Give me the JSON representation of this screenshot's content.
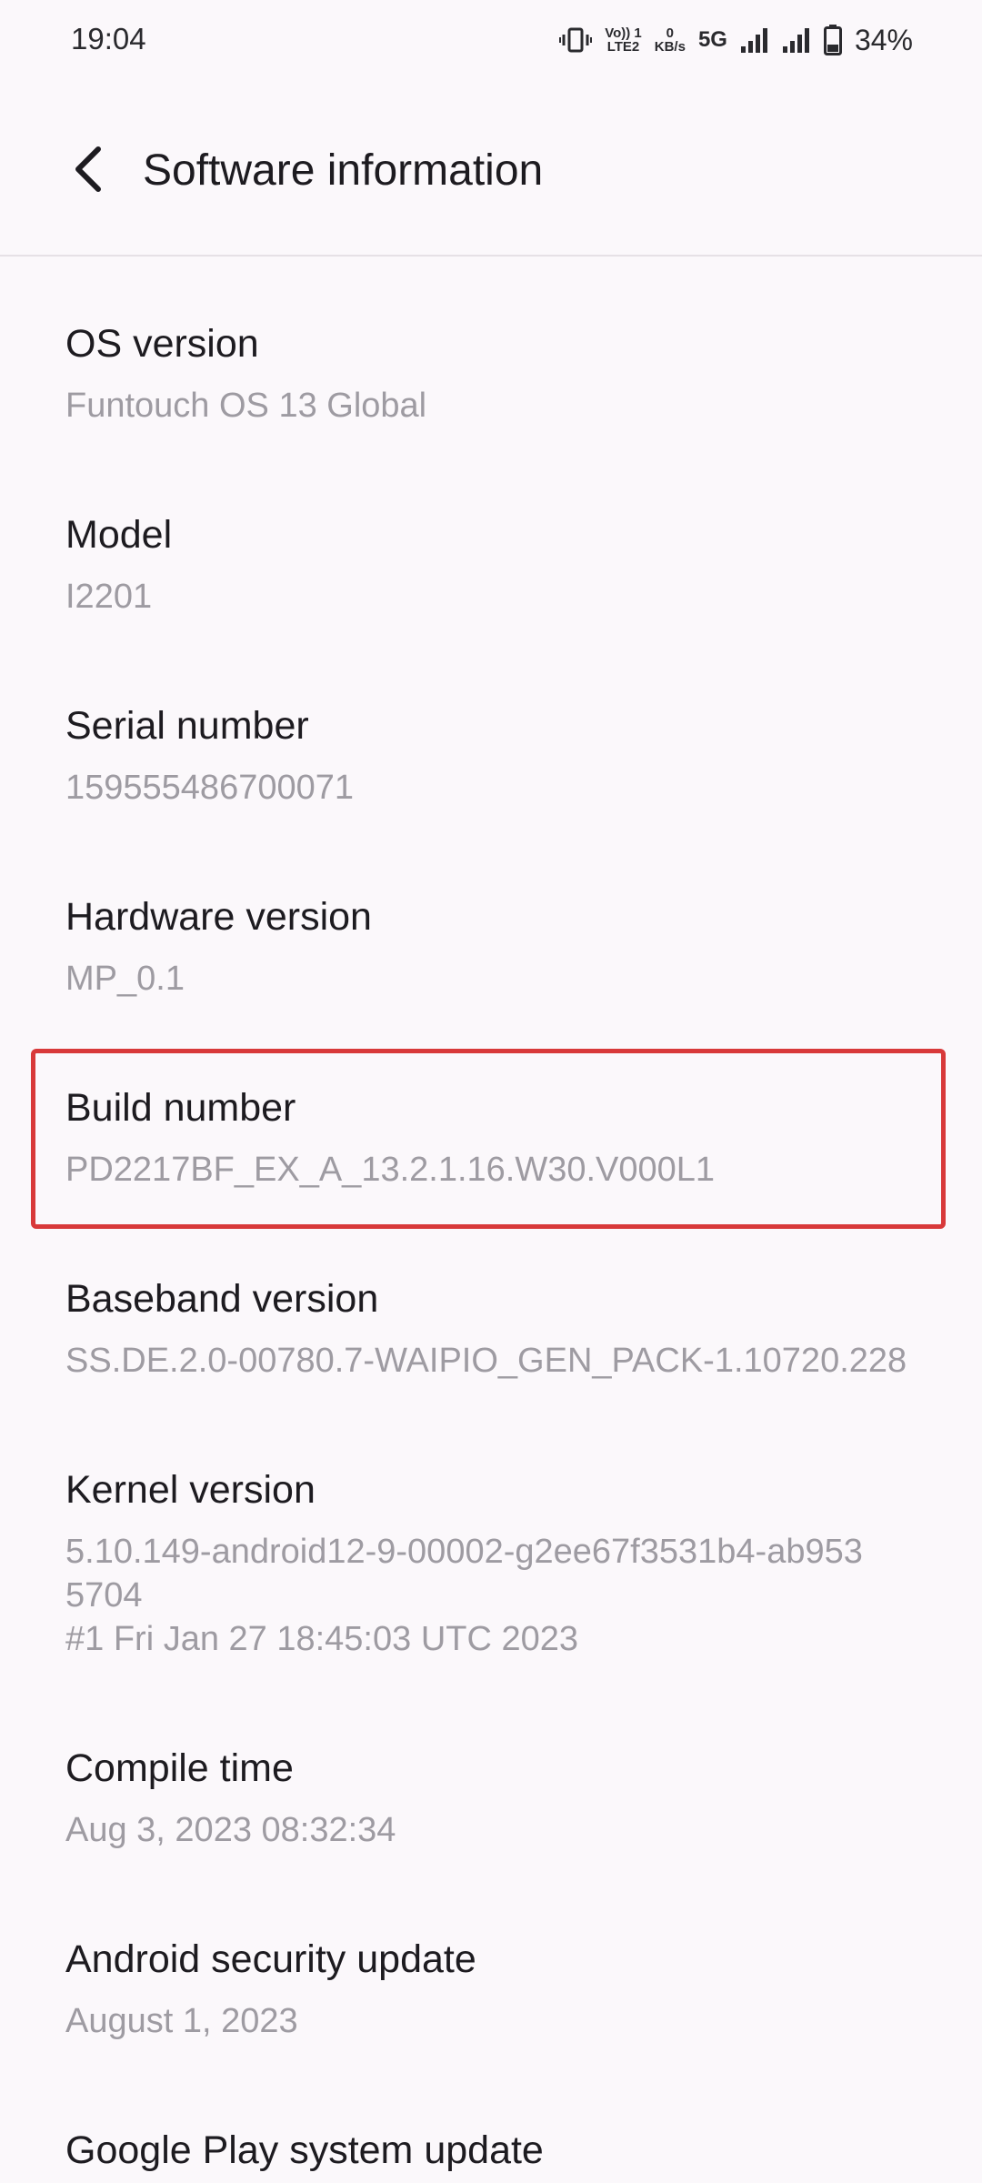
{
  "status_bar": {
    "time": "19:04",
    "volte_top": "Vo)) 1",
    "volte_bottom": "LTE2",
    "speed_top": "0",
    "speed_bottom": "KB/s",
    "network_type": "5G",
    "battery_percent": "34%",
    "icons": [
      "vibrate-icon",
      "volte-icon",
      "network-speed-icon",
      "signal-icon",
      "signal-icon",
      "battery-icon"
    ]
  },
  "header": {
    "title": "Software information",
    "back_icon": "chevron-left-icon"
  },
  "items": [
    {
      "title": "OS version",
      "value": "Funtouch OS 13 Global"
    },
    {
      "title": "Model",
      "value": "I2201"
    },
    {
      "title": "Serial number",
      "value": "159555486700071"
    },
    {
      "title": "Hardware version",
      "value": "MP_0.1"
    },
    {
      "title": "Build number",
      "value": "PD2217BF_EX_A_13.2.1.16.W30.V000L1"
    },
    {
      "title": "Baseband version",
      "value": "SS.DE.2.0-00780.7-WAIPIO_GEN_PACK-1.10720.228"
    },
    {
      "title": "Kernel version",
      "value_line1": "5.10.149-android12-9-00002-g2ee67f3531b4-ab953",
      "value_line2": "5704",
      "value_line3": "#1 Fri Jan 27 18:45:03 UTC 2023"
    },
    {
      "title": "Compile time",
      "value": "Aug 3, 2023 08:32:34"
    },
    {
      "title": "Android security update",
      "value": "August 1, 2023"
    },
    {
      "title": "Google Play system update"
    }
  ],
  "highlight": {
    "color": "#d8393a",
    "target": "Build number"
  }
}
